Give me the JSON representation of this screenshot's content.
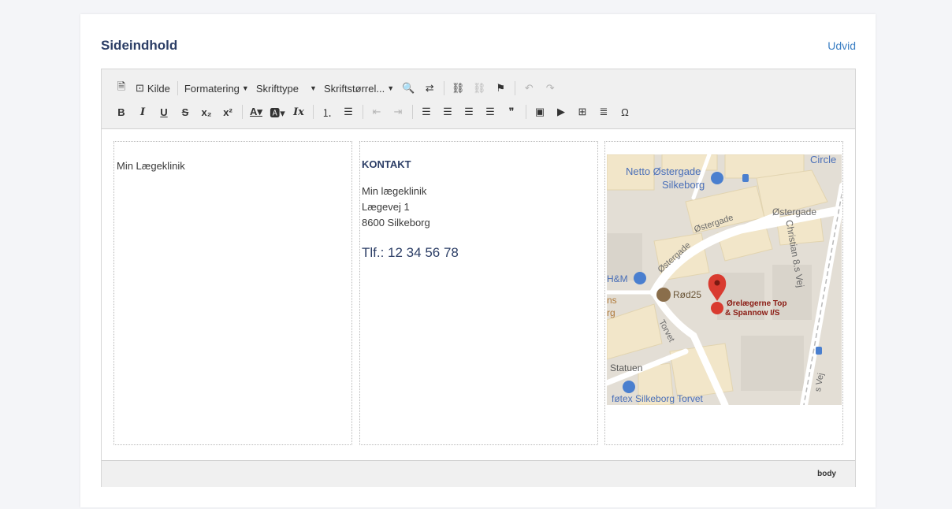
{
  "card": {
    "title": "Sideindhold",
    "expand_label": "Udvid"
  },
  "toolbar": {
    "row1": [
      {
        "name": "new-page-icon",
        "glyph": "🗎",
        "type": "icon"
      },
      {
        "name": "source-button",
        "glyph": "⊡",
        "label": "Kilde",
        "type": "text"
      },
      {
        "type": "sep"
      },
      {
        "name": "format-dropdown",
        "label": "Formatering",
        "type": "drop"
      },
      {
        "name": "font-dropdown",
        "label": "Skrifttype",
        "type": "drop",
        "wide": true
      },
      {
        "name": "font-size-dropdown",
        "label": "Skriftstørrel...",
        "type": "drop"
      },
      {
        "name": "find-icon",
        "glyph": "🔍",
        "type": "icon"
      },
      {
        "name": "replace-icon",
        "glyph": "⇄",
        "type": "icon"
      },
      {
        "type": "sep"
      },
      {
        "name": "link-icon",
        "glyph": "⛓",
        "type": "icon"
      },
      {
        "name": "unlink-icon",
        "glyph": "⛓",
        "type": "icon",
        "disabled": true
      },
      {
        "name": "anchor-flag-icon",
        "glyph": "⚑",
        "type": "icon"
      },
      {
        "type": "sep"
      },
      {
        "name": "undo-icon",
        "glyph": "↶",
        "type": "icon",
        "disabled": true
      },
      {
        "name": "redo-icon",
        "glyph": "↷",
        "type": "icon",
        "disabled": true
      }
    ],
    "row2": [
      {
        "name": "bold-icon",
        "glyph": "B",
        "type": "icon",
        "style": "bold"
      },
      {
        "name": "italic-icon",
        "glyph": "I",
        "type": "icon",
        "style": "italic"
      },
      {
        "name": "underline-icon",
        "glyph": "U",
        "type": "icon",
        "style": "underline"
      },
      {
        "name": "strikethrough-icon",
        "glyph": "S",
        "type": "icon",
        "style": "strike"
      },
      {
        "name": "subscript-icon",
        "glyph": "x₂",
        "type": "icon",
        "style": "bold"
      },
      {
        "name": "superscript-icon",
        "glyph": "x²",
        "type": "icon",
        "style": "bold"
      },
      {
        "type": "sep"
      },
      {
        "name": "text-color-icon",
        "glyph": "A▾",
        "type": "icon",
        "style": "underline"
      },
      {
        "name": "background-color-icon",
        "glyph": "🅰▾",
        "type": "icon"
      },
      {
        "name": "remove-format-icon",
        "glyph": "Ix",
        "type": "icon",
        "style": "italic"
      },
      {
        "type": "sep"
      },
      {
        "name": "numbered-list-icon",
        "glyph": "⒈",
        "type": "icon"
      },
      {
        "name": "bulleted-list-icon",
        "glyph": "☰",
        "type": "icon"
      },
      {
        "type": "sep"
      },
      {
        "name": "outdent-icon",
        "glyph": "⇤",
        "type": "icon",
        "disabled": true
      },
      {
        "name": "indent-icon",
        "glyph": "⇥",
        "type": "icon",
        "disabled": true
      },
      {
        "type": "sep"
      },
      {
        "name": "align-left-icon",
        "glyph": "☰",
        "type": "icon"
      },
      {
        "name": "align-center-icon",
        "glyph": "☰",
        "type": "icon"
      },
      {
        "name": "align-right-icon",
        "glyph": "☰",
        "type": "icon"
      },
      {
        "name": "align-justify-icon",
        "glyph": "☰",
        "type": "icon"
      },
      {
        "name": "blockquote-icon",
        "glyph": "❞",
        "type": "icon"
      },
      {
        "type": "sep"
      },
      {
        "name": "image-icon",
        "glyph": "▣",
        "type": "icon"
      },
      {
        "name": "youtube-icon",
        "glyph": "▶",
        "type": "icon"
      },
      {
        "name": "table-icon",
        "glyph": "⊞",
        "type": "icon"
      },
      {
        "name": "horizontal-line-icon",
        "glyph": "≣",
        "type": "icon"
      },
      {
        "name": "special-char-icon",
        "glyph": "Ω",
        "type": "icon"
      }
    ]
  },
  "content": {
    "col1_text": "Min Lægeklinik",
    "col2": {
      "heading": "KONTAKT",
      "lines": [
        "Min lægeklinik",
        "Lægevej 1",
        "8600 Silkeborg"
      ],
      "phone": "Tlf.: 12 34 56 78"
    },
    "map_labels": {
      "netto_1": "Netto Østergade",
      "netto_2": "Silkeborg",
      "circle": "Circle",
      "ostergade_1": "Østergade",
      "ostergade_2": "Østergade",
      "ostergade_3": "Østergade",
      "christian": "Christian 8.s Vej",
      "hm": "H&M",
      "rod25": "Rød25",
      "marker_1": "Ørelægerne Top",
      "marker_2": "& Spannow I/S",
      "torvet": "Torvet",
      "statuen": "Statuen",
      "fotex": "føtex Silkeborg Torvet",
      "ns": "ns",
      "rg": "rg",
      "vej": "s Vej"
    },
    "colors": {
      "marker": "#d93b30",
      "road": "#ffffff",
      "building": "#f2e6c9",
      "base": "#e3ded5",
      "poi_blue": "#4a7fcf",
      "poi_brown": "#8a6e4b"
    }
  },
  "statusbar": {
    "path": "body"
  }
}
